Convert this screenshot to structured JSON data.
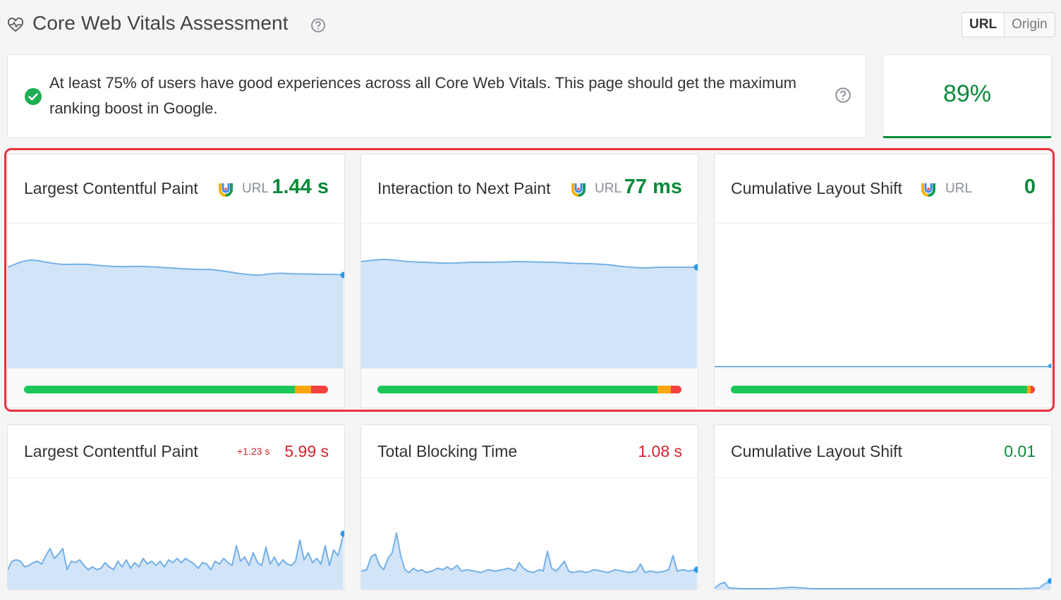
{
  "header": {
    "title": "Core Web Vitals Assessment",
    "toggle": {
      "active": "URL",
      "inactive": "Origin"
    }
  },
  "assessment": {
    "message": "At least 75% of users have good experiences across all Core Web Vitals. This page should get the maximum ranking boost in Google.",
    "score": "89%"
  },
  "colors": {
    "good": "#1dc65a",
    "needs_improvement": "#ffa60e",
    "poor": "#f3433f",
    "value_good": "#0a8a3a",
    "value_poor": "#d3242d",
    "highlight": "#e8323c",
    "chart_fill": "#d2e5f8",
    "chart_line": "#74b0e8"
  },
  "field_metrics": [
    {
      "title": "Largest Contentful Paint",
      "source": "URL",
      "value": "1.44 s",
      "distribution": {
        "good": 0.89,
        "needs_improvement": 0.055,
        "poor": 0.055
      }
    },
    {
      "title": "Interaction to Next Paint",
      "source": "URL",
      "value": "77 ms",
      "distribution": {
        "good": 0.92,
        "needs_improvement": 0.045,
        "poor": 0.035
      }
    },
    {
      "title": "Cumulative Layout Shift",
      "source": "URL",
      "value": "0",
      "distribution": {
        "good": 0.975,
        "needs_improvement": 0.012,
        "poor": 0.013
      }
    }
  ],
  "lab_metrics": [
    {
      "title": "Largest Contentful Paint",
      "delta": "+1.23 s",
      "value": "5.99 s"
    },
    {
      "title": "Total Blocking Time",
      "value": "1.08 s"
    },
    {
      "title": "Cumulative Layout Shift",
      "value": "0.01"
    }
  ]
}
